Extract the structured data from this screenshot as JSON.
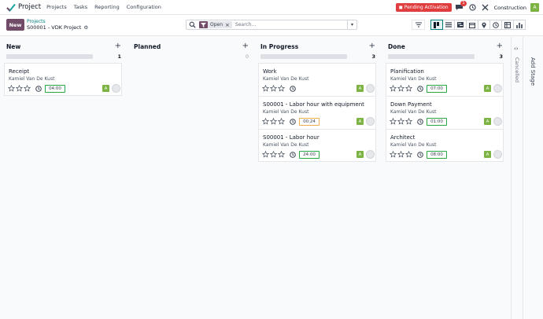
{
  "navbar": {
    "app_name": "Project",
    "menu": [
      "Projects",
      "Tasks",
      "Reporting",
      "Configuration"
    ],
    "pending_label": "Pending Activation",
    "chat_badge": "1",
    "company": "Construction",
    "user_initial": "A"
  },
  "control": {
    "new_label": "New",
    "breadcrumb_parent": "Projects",
    "breadcrumb_current": "S00001 - VDK Project",
    "facet_value": "Open",
    "search_placeholder": "Search..."
  },
  "kanban": {
    "columns": [
      {
        "title": "New",
        "count": "1",
        "cards": [
          {
            "title": "Receipt",
            "assignee": "Kamiel Van De Kust",
            "hours": "04:00",
            "avatar": "A"
          }
        ]
      },
      {
        "title": "Planned",
        "count": "0",
        "cards": []
      },
      {
        "title": "In Progress",
        "count": "3",
        "cards": [
          {
            "title": "Work",
            "assignee": "Kamiel Van De Kust",
            "hours": "",
            "avatar": "A"
          },
          {
            "title": "S00001 - Labor hour with equipment",
            "assignee": "Kamiel Van De Kust",
            "hours": "00:24",
            "avatar": "A"
          },
          {
            "title": "S00001 - Labor hour",
            "assignee": "Kamiel Van De Kust",
            "hours": "24:00",
            "avatar": "A"
          }
        ]
      },
      {
        "title": "Done",
        "count": "3",
        "cards": [
          {
            "title": "Planification",
            "assignee": "Kamiel Van De Kust",
            "hours": "07:00",
            "avatar": "A"
          },
          {
            "title": "Down Payment",
            "assignee": "Kamiel Van De Kust",
            "hours": "01:00",
            "avatar": "A"
          },
          {
            "title": "Architect",
            "assignee": "Kamiel Van De Kust",
            "hours": "08:00",
            "avatar": "A"
          }
        ]
      }
    ],
    "folded_stage": "Cancelled",
    "add_stage_label": "Add Stage"
  },
  "colors": {
    "brand": "#714b67",
    "accent": "#017e84",
    "danger": "#e03e3e",
    "avatar": "#7cb342",
    "hours_ok": "#28a745",
    "hours_warn": "#f0ad4e"
  }
}
